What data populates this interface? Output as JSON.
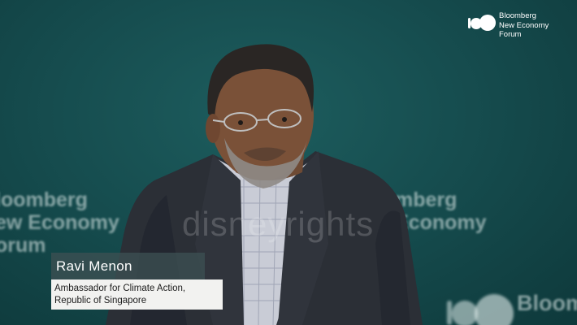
{
  "logo": {
    "lines": [
      "Bloomberg",
      "New Economy",
      "Forum"
    ]
  },
  "backdrop": {
    "left_lines": [
      "loomberg",
      "ew Economy",
      "orum"
    ],
    "right_lines": [
      "mberg",
      "Economy"
    ],
    "bottom_text": "Bloom"
  },
  "watermark": "disneyrights",
  "lower_third": {
    "name": "Ravi Menon",
    "title_lines": [
      "Ambassador for Climate Action,",
      "Republic of Singapore"
    ]
  },
  "colors": {
    "backdrop": "#164d4f",
    "name_bar": "#3c5052",
    "title_bar": "#f2f2f0"
  }
}
